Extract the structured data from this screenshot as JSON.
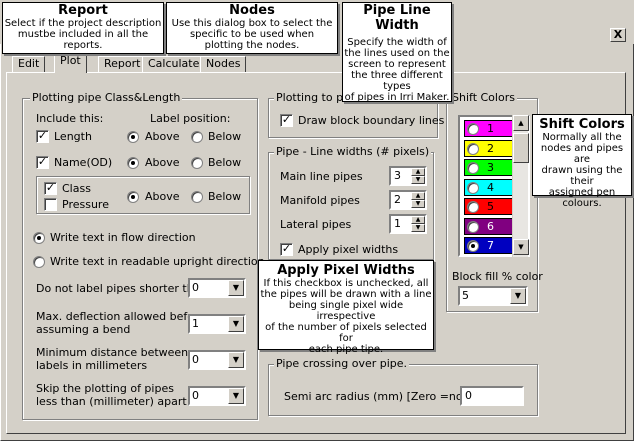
{
  "tooltips": {
    "report": {
      "title": "Report",
      "lines": [
        "Select if the project description",
        "mustbe included in all the reports."
      ]
    },
    "nodes": {
      "title": "Nodes",
      "lines": [
        "Use this dialog box to select the",
        "specific   to be used when",
        "plotting the nodes."
      ]
    },
    "pipe_line_width": {
      "title": "Pipe Line Width",
      "lines": [
        "Specify the width of",
        "the lines used on the",
        "screen to represent",
        "the three different",
        "types",
        "of pipes in Irri Maker."
      ]
    },
    "shift_colors": {
      "title": "Shift Colors",
      "lines": [
        "Normally all the",
        "nodes and pipes are",
        "drawn using the their",
        "assigned pen",
        "colours."
      ]
    },
    "apply_pixel_widths": {
      "title": "Apply Pixel Widths",
      "lines": [
        "If this checkbox is unchecked, all",
        "the pipes will be drawn with a line",
        "being single pixel wide irrespective",
        "of the number of pixels selected for",
        "each pipe tipe."
      ]
    }
  },
  "window": {
    "close_label": "X"
  },
  "tabs": [
    {
      "label": "Edit"
    },
    {
      "label": "Plot"
    },
    {
      "label": "Report"
    },
    {
      "label": "Calculate"
    },
    {
      "label": "Nodes"
    }
  ],
  "plotting_pipe": {
    "title": "Plotting pipe Class&Length",
    "include_header": "Include this:",
    "label_pos_header": "Label position:",
    "rows": [
      {
        "label": "Length",
        "checked": true,
        "above_label": "Above",
        "below_label": "Below",
        "selected": "above"
      },
      {
        "label": "Name(OD)",
        "checked": true,
        "above_label": "Above",
        "below_label": "Below",
        "selected": "above"
      },
      {
        "label": "Class",
        "checked": true,
        "above_label": "Above",
        "below_label": "Below",
        "selected": "above"
      }
    ],
    "pressure_label": "Pressure",
    "pressure_checked": false,
    "flow_direction_label": "Write text in flow direction",
    "upright_direction_label": "Write text in readable upright direction",
    "short_pipes_label": "Do not label pipes shorter than",
    "short_pipes_value": "0",
    "deflection_label_1": "Max. deflection allowed before",
    "deflection_label_2": "assuming a bend",
    "deflection_value": "1",
    "min_distance_label_1": "Minimum distance between",
    "min_distance_label_2": "labels in millimeters",
    "min_distance_value": "0",
    "skip_label_1": "Skip the plotting of pipes",
    "skip_label_2": "less than (millimeter) apart",
    "skip_value": "0"
  },
  "plotting_polygon": {
    "title": "Plotting to plo",
    "draw_block_label": "Draw block boundary lines",
    "draw_block_checked": true
  },
  "pipe_widths": {
    "title": "Pipe - Line widths (# pixels)",
    "main_label": "Main line pipes",
    "main_value": "3",
    "manifold_label": "Manifold pipes",
    "manifold_value": "2",
    "lateral_label": "Lateral pipes",
    "lateral_value": "1",
    "apply_label": "Apply pixel widths",
    "apply_checked": true
  },
  "shift_colors": {
    "title": "Shift Colors",
    "items": [
      {
        "label": "1",
        "color": "#ff00ff",
        "selected": false
      },
      {
        "label": "2",
        "color": "#ffff00",
        "selected": false
      },
      {
        "label": "3",
        "color": "#00ff00",
        "selected": false
      },
      {
        "label": "4",
        "color": "#00ffff",
        "selected": false
      },
      {
        "label": "5",
        "color": "#ff0000",
        "selected": false
      },
      {
        "label": "6",
        "color": "#800080",
        "selected": false
      },
      {
        "label": "7",
        "color": "#0000c0",
        "selected": true
      }
    ],
    "block_fill_label": "Block fill % color",
    "block_fill_value": "5"
  },
  "pipe_crossing": {
    "title": "Pipe crossing over pipe.",
    "semi_arc_label": "Semi arc radius (mm)  [Zero =none}",
    "semi_arc_value": "0"
  }
}
